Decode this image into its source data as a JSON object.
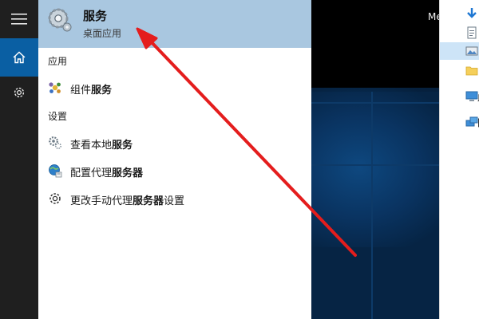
{
  "search": {
    "best_match": {
      "title": "服务",
      "subtitle": "桌面应用"
    },
    "sections": [
      {
        "heading": "应用",
        "items": [
          {
            "pre": "组件",
            "bold": "服务",
            "post": ""
          }
        ]
      },
      {
        "heading": "设置",
        "items": [
          {
            "pre": "查看本地",
            "bold": "服务",
            "post": ""
          },
          {
            "pre": "配置代理",
            "bold": "服务器",
            "post": ""
          },
          {
            "pre": "更改手动代理",
            "bold": "服务器",
            "post": "设置"
          }
        ]
      }
    ]
  },
  "desktop": {
    "visible_text": "Me"
  },
  "explorer": {
    "items": [
      {
        "label": ""
      },
      {
        "label": ""
      },
      {
        "label": ""
      },
      {
        "label": ""
      },
      {
        "label": "此"
      },
      {
        "label": "网"
      }
    ]
  },
  "colors": {
    "accent": "#0a5fa3",
    "highlight": "#a9c7e0",
    "arrow": "#e41d1d"
  },
  "icons": {
    "rail": [
      "hamburger-menu-icon",
      "home-icon",
      "settings-gear-icon"
    ],
    "best_match": "gear-services-icon",
    "results": [
      "component-services-icon",
      "local-services-icon",
      "proxy-settings-icon",
      "gear-icon"
    ]
  }
}
